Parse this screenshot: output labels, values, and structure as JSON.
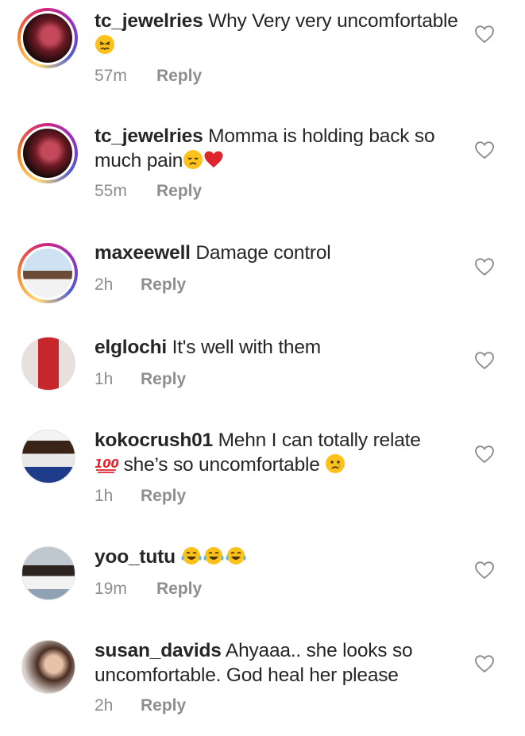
{
  "comments": [
    {
      "username": "tc_jewelries",
      "text": "Why Very very uncomfortable",
      "emojis_after": [
        "persevering-face-emoji"
      ],
      "time": "57m",
      "reply": "Reply",
      "story_ring": true
    },
    {
      "username": "tc_jewelries",
      "text": "Momma is holding back so much pain",
      "emojis_after": [
        "disappointed-face-emoji",
        "red-heart-emoji"
      ],
      "time": "55m",
      "reply": "Reply",
      "story_ring": true
    },
    {
      "username": "maxeewell",
      "text": "Damage control",
      "emojis_after": [],
      "time": "2h",
      "reply": "Reply",
      "story_ring": true
    },
    {
      "username": "elglochi",
      "text": "It's well with them",
      "emojis_after": [],
      "time": "1h",
      "reply": "Reply",
      "story_ring": false
    },
    {
      "username": "kokocrush01",
      "text": "Mehn I can totally relate",
      "text_line2": "she’s so uncomfortable",
      "emojis_after": [
        "hundred-points-emoji",
        "crying-face-emoji"
      ],
      "time": "1h",
      "reply": "Reply",
      "story_ring": false
    },
    {
      "username": "yoo_tutu",
      "text": "",
      "emojis_after": [
        "tears-of-joy-emoji",
        "tears-of-joy-emoji",
        "tears-of-joy-emoji"
      ],
      "time": "19m",
      "reply": "Reply",
      "story_ring": false
    },
    {
      "username": "susan_davids",
      "text": "Ahyaaa.. she looks so uncomfortable. God heal her please",
      "emojis_after": [],
      "time": "2h",
      "reply": "Reply",
      "story_ring": false
    }
  ],
  "colors": {
    "text": "#262626",
    "meta": "#8e8e8e",
    "heart_outline": "#8e8e8e",
    "emoji_yellow": "#fcc21b",
    "heart_red": "#e0242c"
  },
  "icons": {
    "like": "heart-outline-icon"
  }
}
